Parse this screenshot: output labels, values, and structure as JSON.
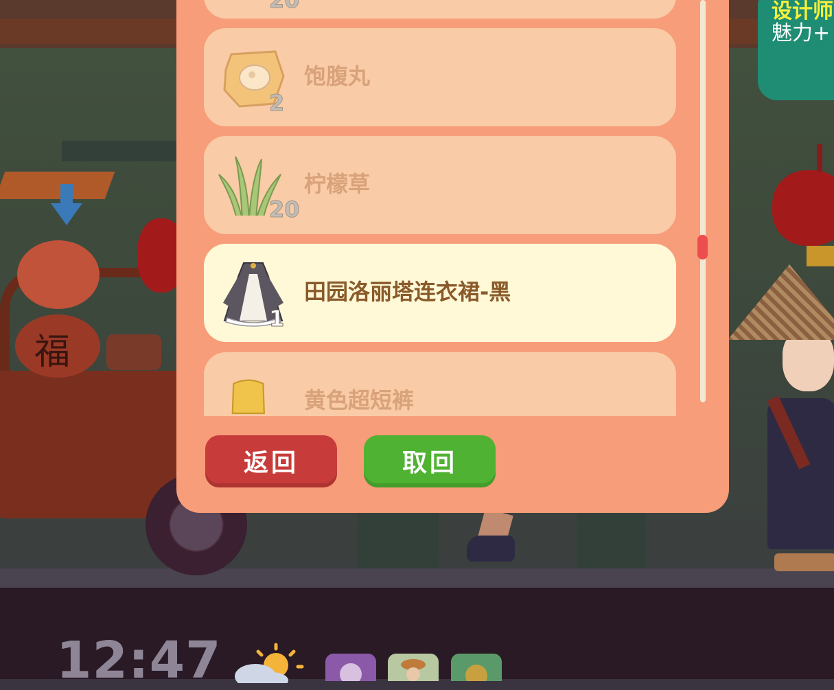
{
  "banner": {
    "title": "设计师",
    "subtitle": "魅力+"
  },
  "inventory": {
    "items": [
      {
        "name": "",
        "count": "20",
        "icon": "partial-item-icon",
        "selected": false
      },
      {
        "name": "饱腹丸",
        "count": "2",
        "icon": "dumpling-icon",
        "selected": false
      },
      {
        "name": "柠檬草",
        "count": "20",
        "icon": "lemongrass-icon",
        "selected": false
      },
      {
        "name": "田园洛丽塔连衣裙-黑",
        "count": "1",
        "icon": "dress-icon",
        "selected": true
      },
      {
        "name": "黄色超短裤",
        "count": "",
        "icon": "yellow-shorts-icon",
        "selected": false
      }
    ],
    "back_label": "返回",
    "retrieve_label": "取回"
  },
  "hud": {
    "time": "12:47",
    "weather_icon": "partly-cloudy-icon"
  },
  "scene": {
    "stall_sign": "福"
  },
  "colors": {
    "panel": "#f89d79",
    "card": "#f9cba6",
    "card_selected": "#fff9d8",
    "back_button": "#c73c3a",
    "retrieve_button": "#4fb232",
    "scroll_thumb": "#ee4d4d"
  }
}
